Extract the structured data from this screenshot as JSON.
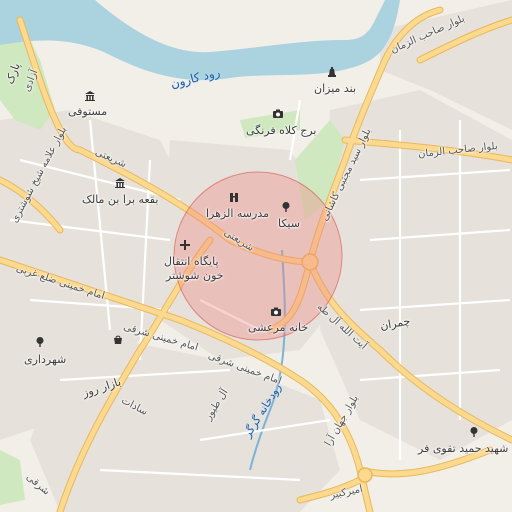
{
  "map": {
    "colors": {
      "land": "#f2efe9",
      "block": "#e6e2db",
      "water": "#aad3df",
      "park": "#cfe8c0",
      "major_road": "#fbd98f",
      "major_road_casing": "#e8b85c",
      "minor_road": "#ffffff",
      "highlight_fill": "#f08080",
      "highlight_stroke": "#d9534f"
    },
    "river_label": "رود کارون",
    "river_label_2": "رودخانه گرگر",
    "places": [
      {
        "name": "پارک",
        "icon": "none"
      },
      {
        "name": "مستوفی",
        "icon": "bank-icon"
      },
      {
        "name": "بند میزان",
        "icon": "monument-icon"
      },
      {
        "name": "برج کلاه فرنگی",
        "icon": "camera-icon"
      },
      {
        "name": "بقعه برا بن مالک",
        "icon": "bank-icon"
      },
      {
        "name": "مدرسه الزهرا",
        "icon": "school-icon"
      },
      {
        "name": "سیکا",
        "icon": "tree-icon"
      },
      {
        "name": "پایگاه انتقال",
        "icon": "hospital-cross-icon"
      },
      {
        "name": "خون شوشتر",
        "icon": "none"
      },
      {
        "name": "خانه مرعشی",
        "icon": "camera-icon"
      },
      {
        "name": "شهرداری",
        "icon": "tree-icon"
      },
      {
        "name": "بازار روز",
        "icon": "market-icon"
      },
      {
        "name": "شهید حمید تقوی فر",
        "icon": "tree-icon"
      },
      {
        "name": "چمران",
        "icon": "none"
      }
    ],
    "roads": [
      "بلوار صاحب الزمان",
      "بلوار صاحب الزمان",
      "بلوار سید مجتبی کاشانی",
      "بلوار علامه شیخ شوشتری",
      "شریعتی",
      "شریعتی",
      "امام خمینی ضلع غربی",
      "امام خمینی شرقی",
      "امام خمینی شرقی",
      "آیت الله آل طه",
      "بلوار جهان آرا",
      "آل طیور",
      "سادات",
      "امیرکبیر",
      "آزادی",
      "شرقی"
    ]
  }
}
